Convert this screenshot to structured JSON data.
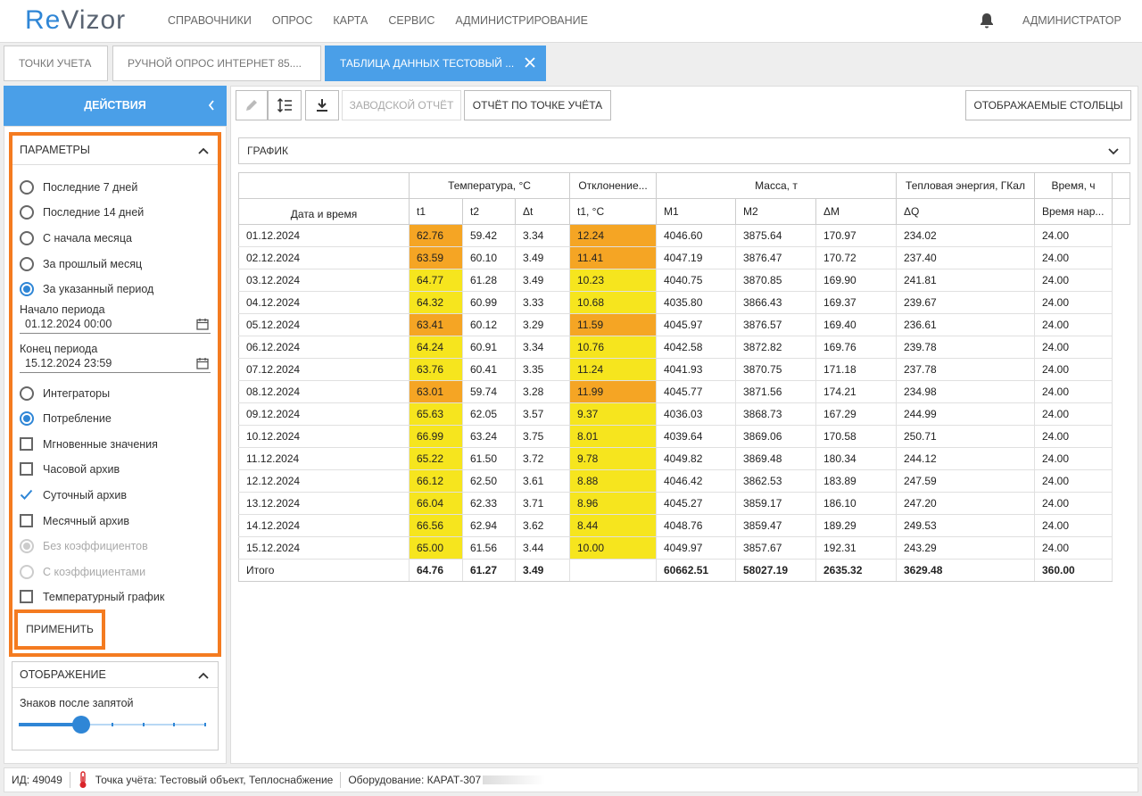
{
  "app": {
    "logo_re": "Re",
    "logo_rest": "Vizor"
  },
  "nav": [
    "СПРАВОЧНИКИ",
    "ОПРОС",
    "КАРТА",
    "СЕРВИС",
    "АДМИНИСТРИРОВАНИЕ"
  ],
  "user": "АДМИНИСТРАТОР",
  "tabs": [
    {
      "label": "ТОЧКИ УЧЕТА"
    },
    {
      "label": "РУЧНОЙ ОПРОС ИНТЕРНЕТ 85...."
    },
    {
      "label": "ТАБЛИЦА ДАННЫХ ТЕСТОВЫЙ ..."
    }
  ],
  "left": {
    "actions_label": "ДЕЙСТВИЯ",
    "params_title": "ПАРАМЕТРЫ",
    "period_options": [
      "Последние 7 дней",
      "Последние 14 дней",
      "С начала месяца",
      "За прошлый месяц",
      "За указанный период"
    ],
    "start_label": "Начало периода",
    "start_value": "01.12.2024 00:00",
    "end_label": "Конец периода",
    "end_value": "15.12.2024 23:59",
    "mode_options": [
      "Интеграторы",
      "Потребление"
    ],
    "archive_options": [
      "Мгновенные значения",
      "Часовой архив",
      "Суточный архив",
      "Месячный архив"
    ],
    "coef_options": [
      "Без коэффициентов",
      "С коэффициентами"
    ],
    "temp_graph": "Температурный график",
    "apply": "ПРИМЕНИТЬ",
    "display_title": "ОТОБРАЖЕНИЕ",
    "decimals_label": "Знаков после запятой",
    "decimals_level": 2
  },
  "toolbar": {
    "factory_report": "ЗАВОДСКОЙ ОТЧЁТ",
    "point_report": "ОТЧЁТ ПО ТОЧКЕ УЧЁТА",
    "columns": "ОТОБРАЖАЕМЫЕ СТОЛБЦЫ"
  },
  "graph_title": "ГРАФИК",
  "table": {
    "groups": [
      "Температура, °С",
      "Отклонение...",
      "Масса, т",
      "Тепловая энергия, ГКал",
      "Время, ч"
    ],
    "columns": [
      "Дата и время",
      "t1",
      "t2",
      "Δt",
      "t1, °С",
      "M1",
      "M2",
      "ΔM",
      "ΔQ",
      "Время нар..."
    ],
    "rows": [
      [
        "01.12.2024",
        "62.76",
        "59.42",
        "3.34",
        "12.24",
        "4046.60",
        "3875.64",
        "170.97",
        "234.02",
        "24.00"
      ],
      [
        "02.12.2024",
        "63.59",
        "60.10",
        "3.49",
        "11.41",
        "4047.19",
        "3876.47",
        "170.72",
        "237.40",
        "24.00"
      ],
      [
        "03.12.2024",
        "64.77",
        "61.28",
        "3.49",
        "10.23",
        "4040.75",
        "3870.85",
        "169.90",
        "241.81",
        "24.00"
      ],
      [
        "04.12.2024",
        "64.32",
        "60.99",
        "3.33",
        "10.68",
        "4035.80",
        "3866.43",
        "169.37",
        "239.67",
        "24.00"
      ],
      [
        "05.12.2024",
        "63.41",
        "60.12",
        "3.29",
        "11.59",
        "4045.97",
        "3876.57",
        "169.40",
        "236.61",
        "24.00"
      ],
      [
        "06.12.2024",
        "64.24",
        "60.91",
        "3.34",
        "10.76",
        "4042.58",
        "3872.82",
        "169.76",
        "239.78",
        "24.00"
      ],
      [
        "07.12.2024",
        "63.76",
        "60.41",
        "3.35",
        "11.24",
        "4041.93",
        "3870.75",
        "171.18",
        "237.78",
        "24.00"
      ],
      [
        "08.12.2024",
        "63.01",
        "59.74",
        "3.28",
        "11.99",
        "4045.77",
        "3871.56",
        "174.21",
        "234.98",
        "24.00"
      ],
      [
        "09.12.2024",
        "65.63",
        "62.05",
        "3.57",
        "9.37",
        "4036.03",
        "3868.73",
        "167.29",
        "244.99",
        "24.00"
      ],
      [
        "10.12.2024",
        "66.99",
        "63.24",
        "3.75",
        "8.01",
        "4039.64",
        "3869.06",
        "170.58",
        "250.71",
        "24.00"
      ],
      [
        "11.12.2024",
        "65.22",
        "61.50",
        "3.72",
        "9.78",
        "4049.82",
        "3869.48",
        "180.34",
        "244.12",
        "24.00"
      ],
      [
        "12.12.2024",
        "66.12",
        "62.50",
        "3.61",
        "8.88",
        "4046.42",
        "3862.53",
        "183.89",
        "247.59",
        "24.00"
      ],
      [
        "13.12.2024",
        "66.04",
        "62.33",
        "3.71",
        "8.96",
        "4045.27",
        "3859.17",
        "186.10",
        "247.20",
        "24.00"
      ],
      [
        "14.12.2024",
        "66.56",
        "62.94",
        "3.62",
        "8.44",
        "4048.76",
        "3859.47",
        "189.29",
        "249.53",
        "24.00"
      ],
      [
        "15.12.2024",
        "65.00",
        "61.56",
        "3.44",
        "10.00",
        "4049.97",
        "3857.67",
        "192.31",
        "243.29",
        "24.00"
      ]
    ],
    "highlight": [
      "orange",
      "orange",
      "yellow",
      "yellow",
      "orange",
      "yellow",
      "yellow",
      "orange",
      "yellow",
      "yellow",
      "yellow",
      "yellow",
      "yellow",
      "yellow",
      "yellow"
    ],
    "total": [
      "Итого",
      "64.76",
      "61.27",
      "3.49",
      "",
      "60662.51",
      "58027.19",
      "2635.32",
      "3629.48",
      "360.00"
    ]
  },
  "colors": {
    "orange": "#f5a524",
    "yellow": "#f6e51e",
    "accent": "#4a9fe8",
    "highlight_border": "#f47b20"
  },
  "status": {
    "id": "ИД: 49049",
    "point": "Точка учёта: Тестовый объект, Теплоснабжение",
    "equipment": "Оборудование: КАРАТ-307"
  }
}
